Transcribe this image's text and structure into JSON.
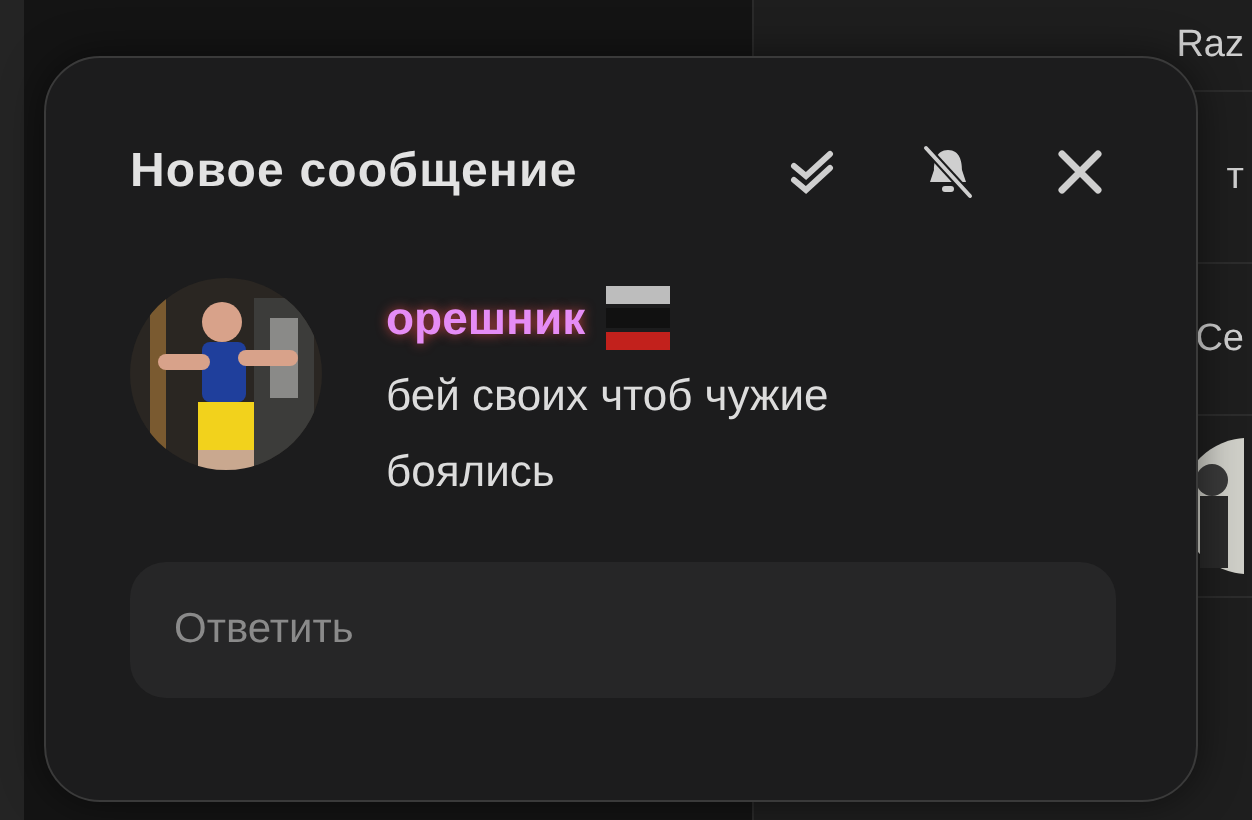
{
  "background_list": [
    {
      "text": "Raz"
    },
    {
      "text": "т"
    },
    {
      "text": "Се"
    }
  ],
  "notification": {
    "title": "Новое сообщение",
    "sender": {
      "name": "орешник",
      "color": "#e58cf5"
    },
    "message": "бей своих чтоб чужие боялись",
    "reply": {
      "placeholder": "Ответить"
    }
  }
}
